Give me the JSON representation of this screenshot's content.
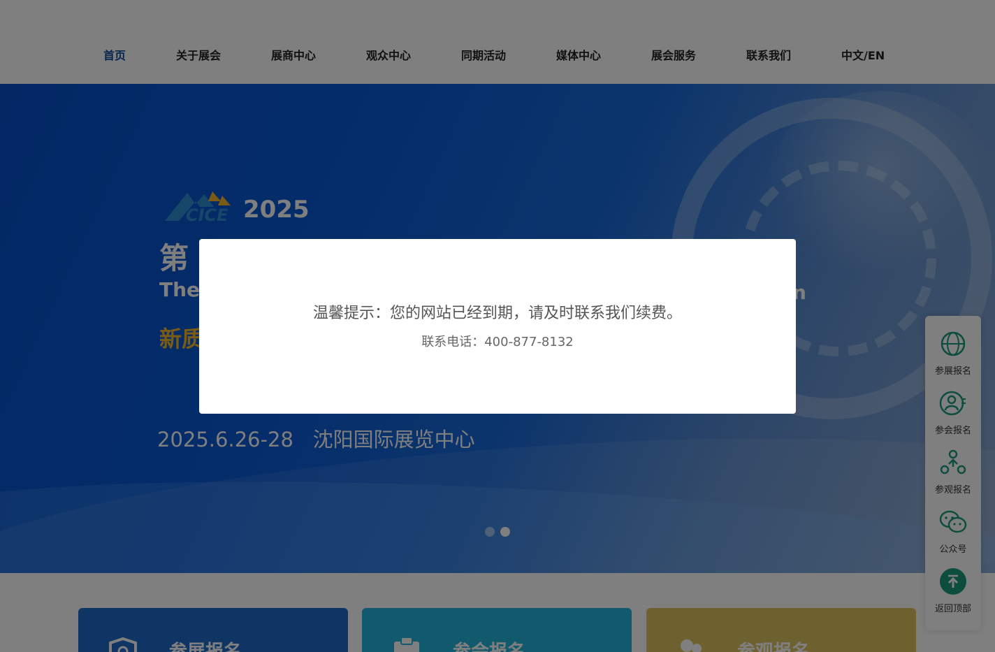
{
  "nav": {
    "items": [
      {
        "label": "首页"
      },
      {
        "label": "关于展会"
      },
      {
        "label": "展商中心"
      },
      {
        "label": "观众中心"
      },
      {
        "label": "同期活动"
      },
      {
        "label": "媒体中心"
      },
      {
        "label": "展会服务"
      },
      {
        "label": "联系我们"
      },
      {
        "label": "中文/EN"
      }
    ],
    "active_index": 0,
    "active_color": "#0a4a9e"
  },
  "banner": {
    "logo_text": "CICE",
    "year": "2025",
    "title_visible": "第",
    "subtitle_en_visible": "The",
    "subtitle_en_tail": "n",
    "slogan_visible": "新质",
    "date": "2025.6.26-28",
    "venue": "沈阳国际展览中心",
    "slide_count": 2,
    "active_slide": 2,
    "accent_color": "#f2b72c"
  },
  "cards": [
    {
      "label": "参展报名",
      "icon": "shield-icon",
      "color": "#1e6bc9"
    },
    {
      "label": "参会报名",
      "icon": "clipboard-icon",
      "color": "#22b3d8"
    },
    {
      "label": "参观报名",
      "icon": "people-icon",
      "color": "#dcc361"
    }
  ],
  "sidebar": {
    "items": [
      {
        "label": "参展报名",
        "icon": "globe-icon"
      },
      {
        "label": "参会报名",
        "icon": "user-icon"
      },
      {
        "label": "参观报名",
        "icon": "group-icon"
      },
      {
        "label": "公众号",
        "icon": "wechat-icon"
      },
      {
        "label": "返回顶部",
        "icon": "back-to-top-icon"
      }
    ],
    "icon_color": "#1a9a7a"
  },
  "modal": {
    "message": "温馨提示：您的网站已经到期，请及时联系我们续费。",
    "phone_line": "联系电话：400-877-8132"
  }
}
